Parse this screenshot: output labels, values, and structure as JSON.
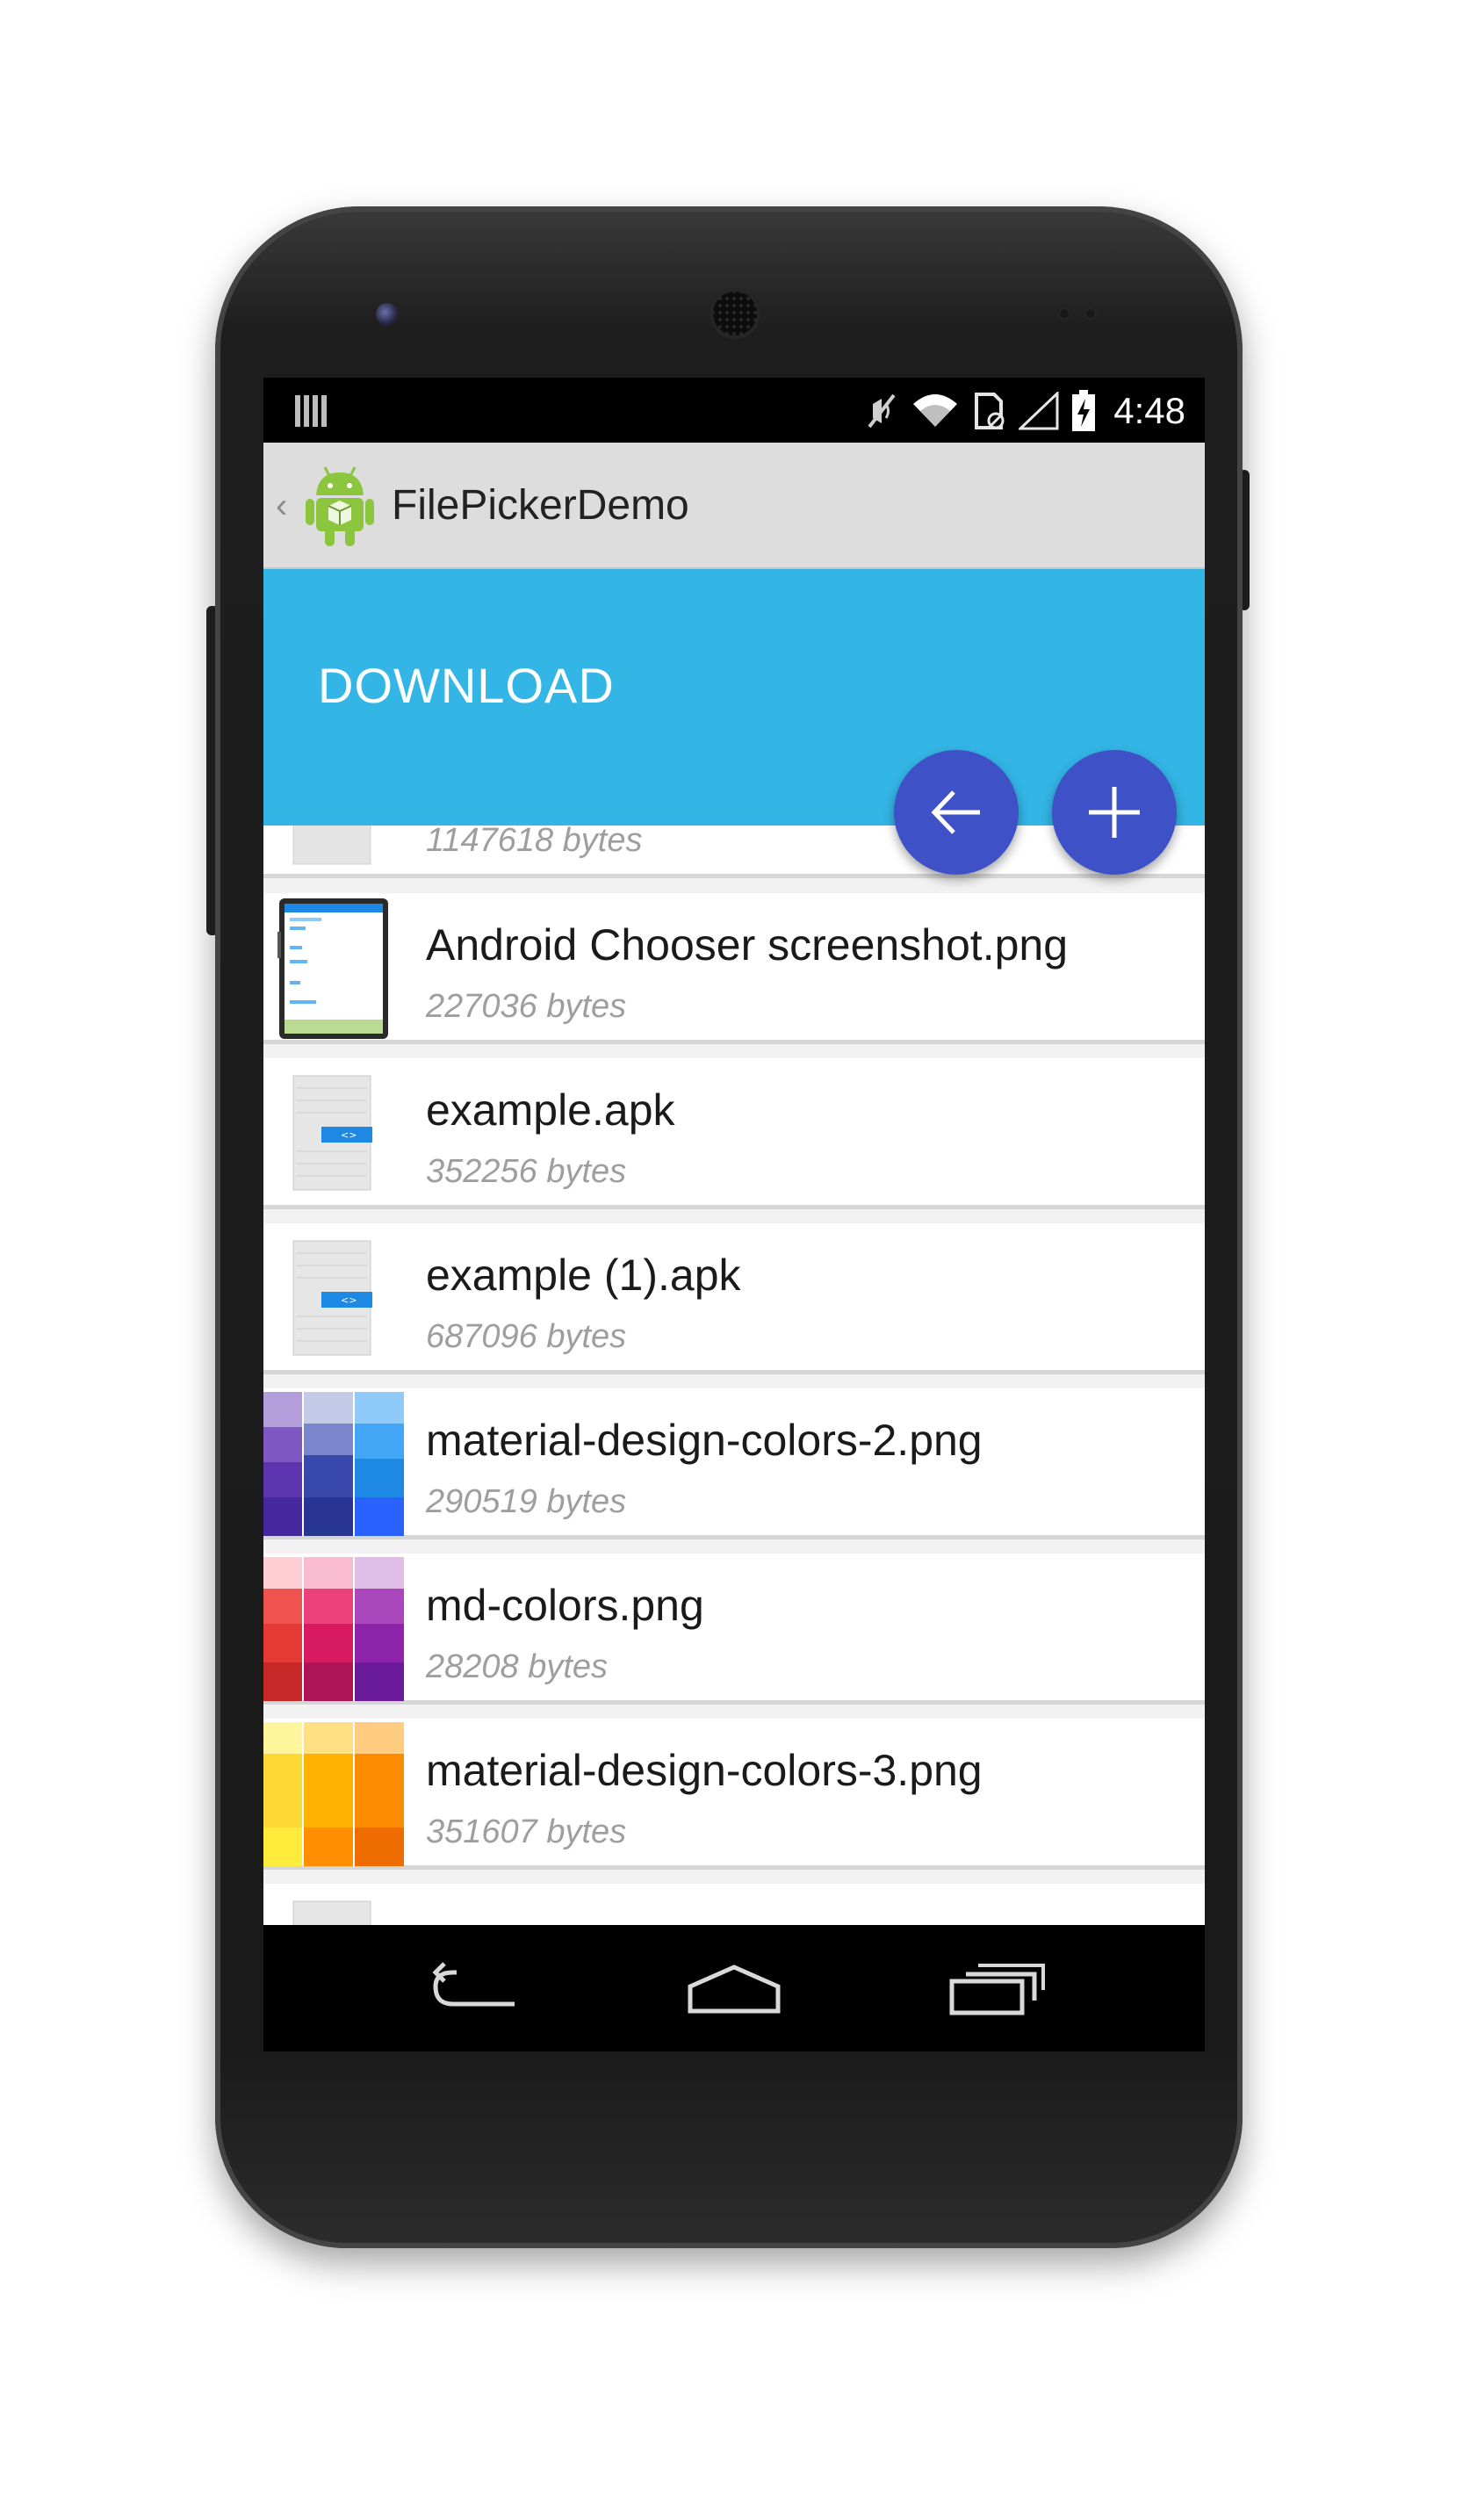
{
  "status_bar": {
    "time": "4:48",
    "icons": [
      "notification-bars-icon",
      "vibrate-mute-icon",
      "wifi-icon",
      "sd-card-icon",
      "signal-icon",
      "battery-charging-icon"
    ]
  },
  "action_bar": {
    "app_title": "FilePickerDemo",
    "icons": [
      "up-caret-icon",
      "android-app-icon"
    ]
  },
  "header": {
    "folder_name": "DOWNLOAD",
    "color": "#33b5e5"
  },
  "fab": {
    "color": "#3f51c7",
    "buttons": [
      "arrow-left-icon",
      "plus-icon"
    ]
  },
  "files": [
    {
      "name": "",
      "size": "1147618 bytes",
      "thumb": "apk-icon"
    },
    {
      "name": "Android Chooser screenshot.png",
      "size": "227036 bytes",
      "thumb": "screenshot"
    },
    {
      "name": "example.apk",
      "size": "352256 bytes",
      "thumb": "apk-icon"
    },
    {
      "name": "example (1).apk",
      "size": "687096 bytes",
      "thumb": "apk-icon"
    },
    {
      "name": "material-design-colors-2.png",
      "size": "290519 bytes",
      "thumb": "blue-palette"
    },
    {
      "name": "md-colors.png",
      "size": "28208 bytes",
      "thumb": "red-palette"
    },
    {
      "name": "material-design-colors-3.png",
      "size": "351607 bytes",
      "thumb": "yellow-palette"
    }
  ],
  "nav_bar": {
    "icons": [
      "back-icon",
      "home-icon",
      "recents-icon"
    ]
  }
}
